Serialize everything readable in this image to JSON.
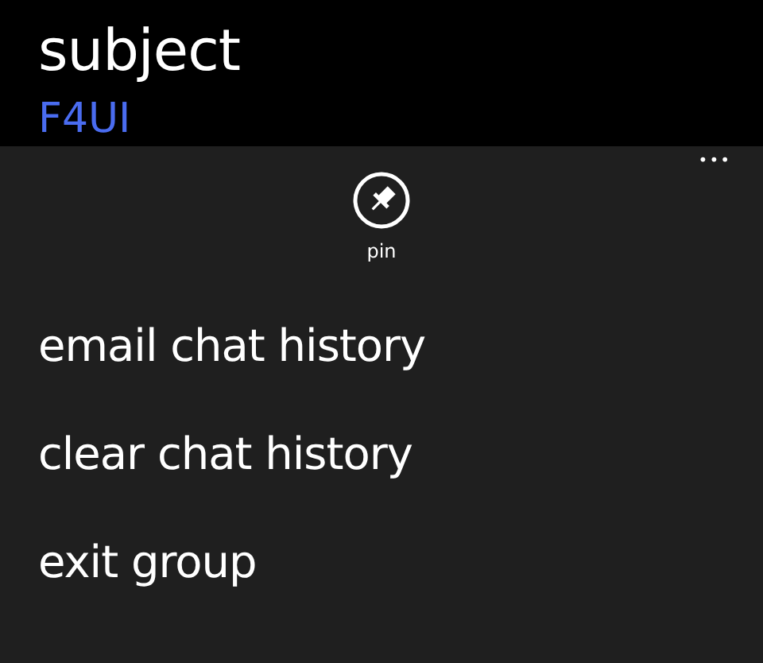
{
  "header": {
    "title": "subject",
    "subtitle": "F4UI"
  },
  "app_bar": {
    "more": "•••",
    "buttons": [
      {
        "label": "pin"
      }
    ],
    "menu_items": [
      "email chat history",
      "clear chat history",
      "exit group"
    ]
  }
}
